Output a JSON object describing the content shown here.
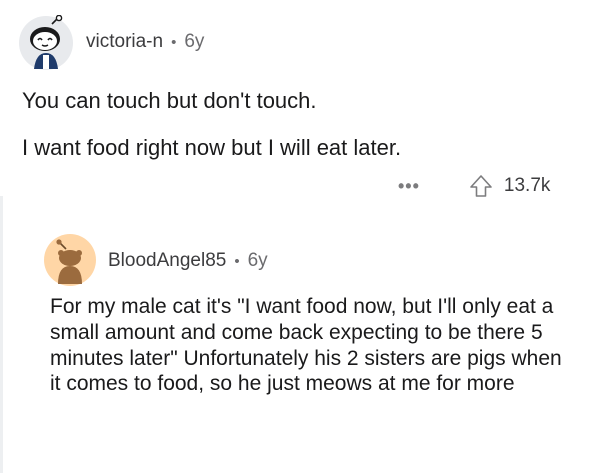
{
  "comment": {
    "author": "victoria-n",
    "age": "6y",
    "paragraphs": [
      "You can touch but don't touch.",
      "I want food right now but I will eat later."
    ],
    "more_label": "•••",
    "upvotes": "13.7k"
  },
  "reply": {
    "author": "BloodAngel85",
    "age": "6y",
    "text": "For my male cat it's \"I want food now, but I'll only eat a small amount and come back expecting to be there 5 minutes later\" Unfortunately his 2 sisters are pigs when it comes to food, so he just meows at me for more"
  },
  "colors": {
    "avatar_ring": "#e8eaed",
    "avatar2_bg": "#ffd6a6",
    "avatar2_body": "#9b6b3e",
    "thread_line": "#edeff1"
  },
  "icons": {
    "avatar1": "snoo-avatar-icon",
    "avatar2": "snoo-avatar-icon",
    "upvote": "upvote-arrow-icon",
    "more": "more-options-icon"
  }
}
